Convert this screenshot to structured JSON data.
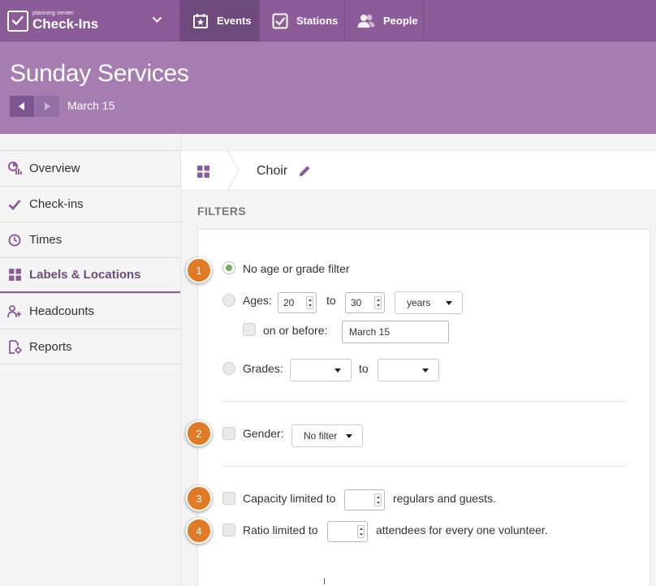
{
  "app": {
    "brand_small": "planning center",
    "brand_name": "Check-Ins"
  },
  "nav": {
    "tabs": [
      {
        "label": "Events",
        "icon": "calendar-star-icon",
        "active": true
      },
      {
        "label": "Stations",
        "icon": "checkbox-icon",
        "active": false
      },
      {
        "label": "People",
        "icon": "people-icon",
        "active": false
      }
    ]
  },
  "header": {
    "title": "Sunday Services",
    "date": "March 15"
  },
  "sidebar": {
    "items": [
      {
        "label": "Overview",
        "icon": "overview-chart-icon"
      },
      {
        "label": "Check-ins",
        "icon": "checkmark-icon"
      },
      {
        "label": "Times",
        "icon": "clock-icon"
      },
      {
        "label": "Labels & Locations",
        "icon": "grid-icon",
        "active": true
      },
      {
        "label": "Headcounts",
        "icon": "headcount-icon"
      },
      {
        "label": "Reports",
        "icon": "report-gear-icon"
      }
    ]
  },
  "breadcrumb": {
    "title": "Choir"
  },
  "filters": {
    "heading": "FILTERS",
    "no_filter_label": "No age or grade filter",
    "ages_label": "Ages:",
    "age_from": "20",
    "age_to_word": "to",
    "age_to": "30",
    "age_unit": "years",
    "on_or_before_label": "on or before:",
    "on_or_before_value": "March 15",
    "grades_label": "Grades:",
    "grades_to_word": "to",
    "grade_from": "",
    "grade_to": "",
    "gender_label": "Gender:",
    "gender_value": "No filter",
    "capacity_label": "Capacity limited to",
    "capacity_value": "",
    "capacity_suffix": "regulars and guests.",
    "ratio_label": "Ratio limited to",
    "ratio_value": "",
    "ratio_suffix": "attendees for every one volunteer."
  },
  "badges": [
    "1",
    "2",
    "3",
    "4"
  ],
  "colors": {
    "nav_bg": "#8c5c99",
    "nav_active": "#6f4a7d",
    "header_bg": "#a57db0",
    "badge": "#e07a24",
    "radio_selected": "#6fae57"
  }
}
